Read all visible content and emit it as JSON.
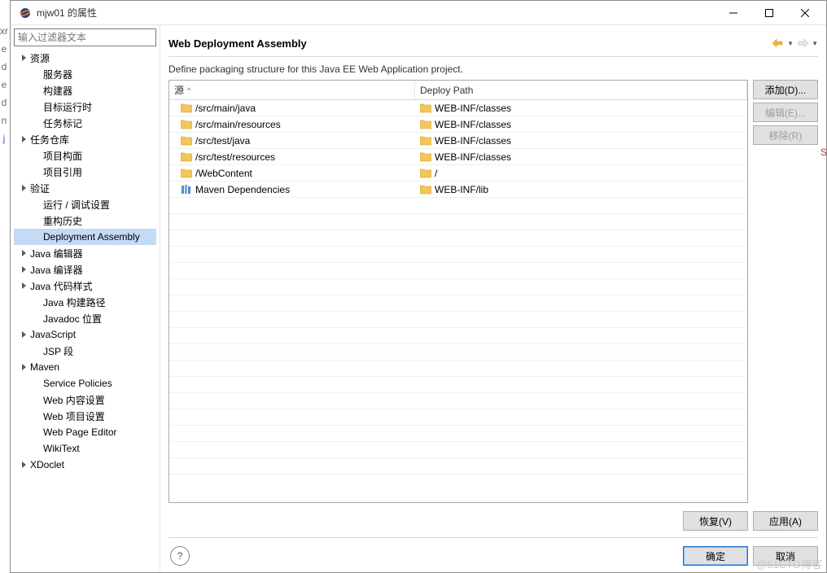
{
  "window": {
    "title": "mjw01 的属性"
  },
  "sidebar": {
    "filter_placeholder": "输入过滤器文本",
    "items": [
      {
        "label": "资源",
        "depth": 0,
        "expandable": true,
        "selected": false
      },
      {
        "label": "服务器",
        "depth": 1,
        "expandable": false,
        "selected": false
      },
      {
        "label": "构建器",
        "depth": 1,
        "expandable": false,
        "selected": false
      },
      {
        "label": "目标运行时",
        "depth": 1,
        "expandable": false,
        "selected": false
      },
      {
        "label": "任务标记",
        "depth": 1,
        "expandable": false,
        "selected": false
      },
      {
        "label": "任务仓库",
        "depth": 0,
        "expandable": true,
        "selected": false
      },
      {
        "label": "项目构面",
        "depth": 1,
        "expandable": false,
        "selected": false
      },
      {
        "label": "项目引用",
        "depth": 1,
        "expandable": false,
        "selected": false
      },
      {
        "label": "验证",
        "depth": 0,
        "expandable": true,
        "selected": false
      },
      {
        "label": "运行 / 调试设置",
        "depth": 1,
        "expandable": false,
        "selected": false
      },
      {
        "label": "重构历史",
        "depth": 1,
        "expandable": false,
        "selected": false
      },
      {
        "label": "Deployment Assembly",
        "depth": 1,
        "expandable": false,
        "selected": true
      },
      {
        "label": "Java 编辑器",
        "depth": 0,
        "expandable": true,
        "selected": false
      },
      {
        "label": "Java 编译器",
        "depth": 0,
        "expandable": true,
        "selected": false
      },
      {
        "label": "Java 代码样式",
        "depth": 0,
        "expandable": true,
        "selected": false
      },
      {
        "label": "Java 构建路径",
        "depth": 1,
        "expandable": false,
        "selected": false
      },
      {
        "label": "Javadoc 位置",
        "depth": 1,
        "expandable": false,
        "selected": false
      },
      {
        "label": "JavaScript",
        "depth": 0,
        "expandable": true,
        "selected": false
      },
      {
        "label": "JSP 段",
        "depth": 1,
        "expandable": false,
        "selected": false
      },
      {
        "label": "Maven",
        "depth": 0,
        "expandable": true,
        "selected": false
      },
      {
        "label": "Service Policies",
        "depth": 1,
        "expandable": false,
        "selected": false
      },
      {
        "label": "Web 内容设置",
        "depth": 1,
        "expandable": false,
        "selected": false
      },
      {
        "label": "Web 项目设置",
        "depth": 1,
        "expandable": false,
        "selected": false
      },
      {
        "label": "Web Page Editor",
        "depth": 1,
        "expandable": false,
        "selected": false
      },
      {
        "label": "WikiText",
        "depth": 1,
        "expandable": false,
        "selected": false
      },
      {
        "label": "XDoclet",
        "depth": 0,
        "expandable": true,
        "selected": false
      }
    ]
  },
  "main": {
    "heading": "Web Deployment Assembly",
    "description": "Define packaging structure for this Java EE Web Application project.",
    "columns": {
      "source": "源",
      "deploy": "Deploy Path"
    },
    "rows": [
      {
        "source": "/src/main/java",
        "deploy": "WEB-INF/classes",
        "icon": "folder"
      },
      {
        "source": "/src/main/resources",
        "deploy": "WEB-INF/classes",
        "icon": "folder"
      },
      {
        "source": "/src/test/java",
        "deploy": "WEB-INF/classes",
        "icon": "folder"
      },
      {
        "source": "/src/test/resources",
        "deploy": "WEB-INF/classes",
        "icon": "folder"
      },
      {
        "source": "/WebContent",
        "deploy": "/",
        "icon": "folder"
      },
      {
        "source": "Maven Dependencies",
        "deploy": "WEB-INF/lib",
        "icon": "lib"
      }
    ],
    "buttons": {
      "add": "添加(D)...",
      "edit": "编辑(E)...",
      "remove": "移除(R)",
      "restore": "恢复(V)",
      "apply": "应用(A)",
      "ok": "确定",
      "cancel": "取消"
    }
  },
  "gutter": [
    "xr",
    "e",
    "d",
    "e",
    "d",
    "n",
    "j"
  ],
  "right_char": "S",
  "watermark": "@51CTO博客"
}
